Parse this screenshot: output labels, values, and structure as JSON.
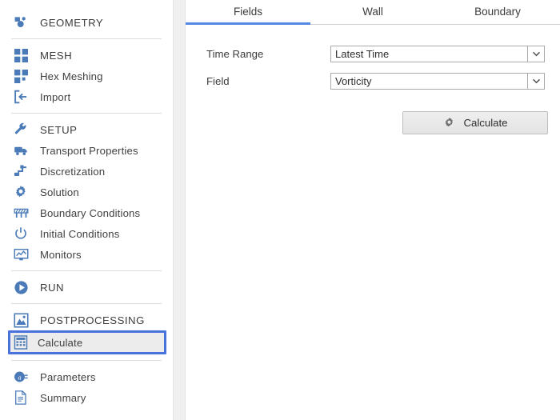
{
  "sidebar": {
    "groups": [
      {
        "items": [
          {
            "label": "GEOMETRY",
            "icon": "geometry-icon",
            "section": true,
            "selected": false
          }
        ]
      },
      {
        "items": [
          {
            "label": "MESH",
            "icon": "mesh-grid-icon",
            "section": true,
            "selected": false
          },
          {
            "label": "Hex Meshing",
            "icon": "hex-meshing-icon",
            "section": false,
            "selected": false
          },
          {
            "label": "Import",
            "icon": "import-icon",
            "section": false,
            "selected": false
          }
        ]
      },
      {
        "items": [
          {
            "label": "SETUP",
            "icon": "wrench-icon",
            "section": true,
            "selected": false
          },
          {
            "label": "Transport Properties",
            "icon": "truck-icon",
            "section": false,
            "selected": false
          },
          {
            "label": "Discretization",
            "icon": "discretization-icon",
            "section": false,
            "selected": false
          },
          {
            "label": "Solution",
            "icon": "gear-icon",
            "section": false,
            "selected": false
          },
          {
            "label": "Boundary Conditions",
            "icon": "barrier-icon",
            "section": false,
            "selected": false
          },
          {
            "label": "Initial Conditions",
            "icon": "power-icon",
            "section": false,
            "selected": false
          },
          {
            "label": "Monitors",
            "icon": "monitor-chart-icon",
            "section": false,
            "selected": false
          }
        ]
      },
      {
        "items": [
          {
            "label": "RUN",
            "icon": "play-circle-icon",
            "section": true,
            "selected": false
          }
        ]
      },
      {
        "items": [
          {
            "label": "POSTPROCESSING",
            "icon": "image-icon",
            "section": true,
            "selected": false
          },
          {
            "label": "Calculate",
            "icon": "calculator-icon",
            "section": false,
            "selected": true
          }
        ]
      },
      {
        "items": [
          {
            "label": "Parameters",
            "icon": "parameters-icon",
            "section": false,
            "selected": false
          },
          {
            "label": "Summary",
            "icon": "document-icon",
            "section": false,
            "selected": false
          }
        ]
      }
    ]
  },
  "main": {
    "tabs": [
      {
        "label": "Fields",
        "active": true
      },
      {
        "label": "Wall",
        "active": false
      },
      {
        "label": "Boundary",
        "active": false
      }
    ],
    "fields": [
      {
        "label": "Time Range",
        "value": "Latest Time",
        "icon": "chevron-down-icon"
      },
      {
        "label": "Field",
        "value": "Vorticity",
        "icon": "chevron-down-icon"
      }
    ],
    "calculate_button": {
      "label": "Calculate",
      "icon": "gear-icon"
    }
  },
  "colors": {
    "accent": "#4a72dd",
    "tab_underline": "#5588e3",
    "icon_blue": "#4a7ab8",
    "selected_bg": "#ececec",
    "text": "#3b3b3b"
  }
}
